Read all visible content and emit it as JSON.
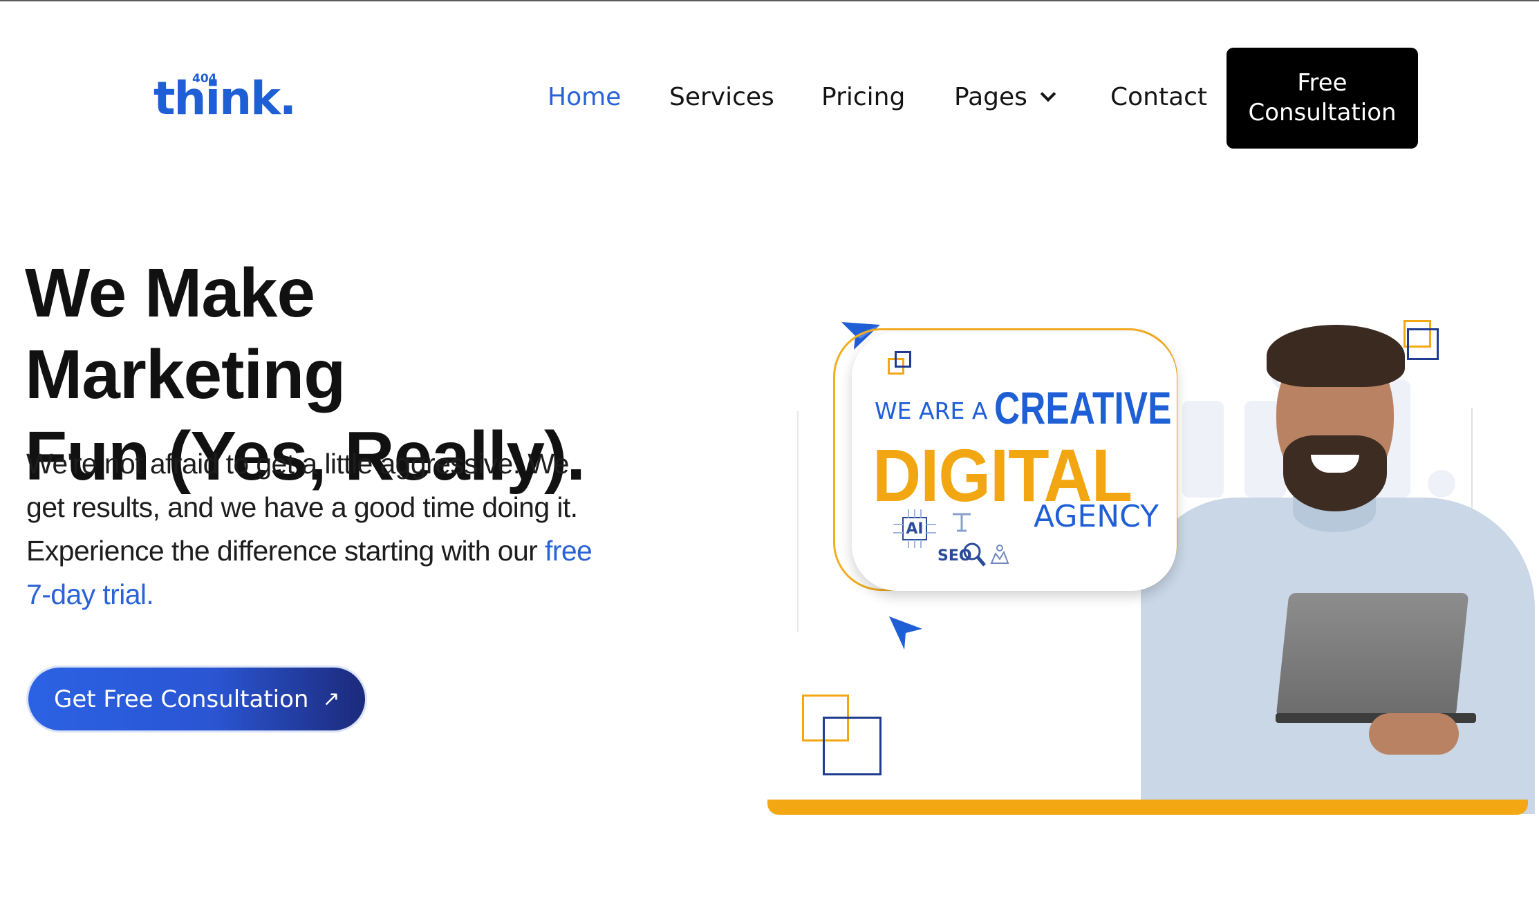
{
  "logo": {
    "text": "think.",
    "badge": "404"
  },
  "nav": {
    "items": [
      {
        "label": "Home",
        "active": true
      },
      {
        "label": "Services",
        "active": false
      },
      {
        "label": "Pricing",
        "active": false
      },
      {
        "label": "Pages",
        "active": false,
        "has_dropdown": true
      },
      {
        "label": "Contact",
        "active": false
      }
    ],
    "cta_line1": "Free",
    "cta_line2": "Consultation"
  },
  "hero": {
    "title_line1": "We Make Marketing",
    "title_line2": "Fun (Yes, Really).",
    "body": "We're not afraid to get a little aggressive. We get results, and we have a good time doing it. Experience the difference starting with our ",
    "body_link": "free 7-day trial.",
    "cta_label": "Get Free Consultation",
    "cta_icon": "arrow-up-right-icon"
  },
  "illustration": {
    "line1": "WE ARE A",
    "line2": "CREATIVE",
    "line3": "DIGITAL",
    "line4": "AGENCY",
    "icon_ai": "AI",
    "icon_seo": "SEO"
  },
  "colors": {
    "brand_blue": "#1f5fd6",
    "accent_orange": "#f3a712",
    "navy": "#1c3a8a",
    "black": "#000000"
  }
}
